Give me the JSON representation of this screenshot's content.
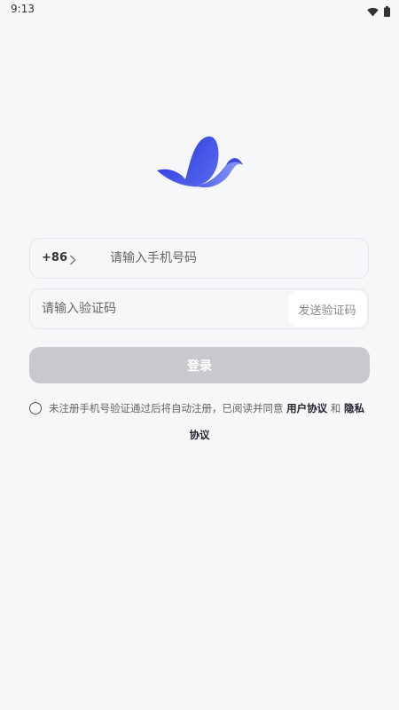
{
  "status_bar": {
    "time": "9:13",
    "icons": [
      "wifi-icon",
      "battery-icon"
    ]
  },
  "logo": {
    "icon": "bird-logo-icon",
    "colors": [
      "#3a4be0",
      "#7b8cf5"
    ]
  },
  "phone_field": {
    "country_code": "+86",
    "placeholder": "请输入手机号码",
    "value": ""
  },
  "code_field": {
    "placeholder": "请输入验证码",
    "value": "",
    "send_label": "发送验证码"
  },
  "login": {
    "label": "登录"
  },
  "agreement": {
    "prefix": "未注册手机号验证通过后将自动注册，已阅读并同意 ",
    "user_agreement": "用户协议",
    "and": " 和 ",
    "privacy_part1": "隐私",
    "privacy_part2": "协议"
  }
}
